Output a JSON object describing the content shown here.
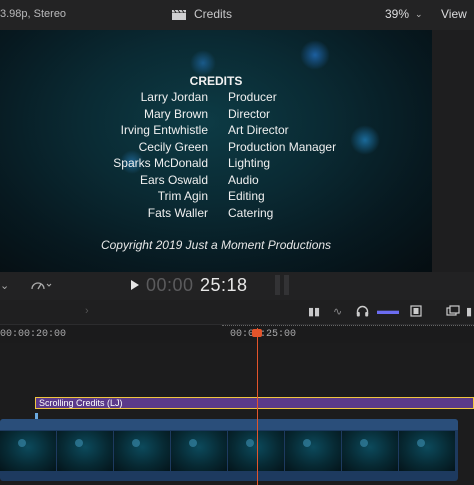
{
  "topbar": {
    "format": "3.98p, Stereo",
    "title": "Credits",
    "zoom": "39%",
    "view_label": "View"
  },
  "viewer": {
    "heading": "CREDITS",
    "credits": [
      {
        "name": "Larry Jordan",
        "role": "Producer"
      },
      {
        "name": "Mary Brown",
        "role": "Director"
      },
      {
        "name": "Irving Entwhistle",
        "role": "Art Director"
      },
      {
        "name": "Cecily Green",
        "role": "Production Manager"
      },
      {
        "name": "Sparks McDonald",
        "role": "Lighting"
      },
      {
        "name": "Ears Oswald",
        "role": "Audio"
      },
      {
        "name": "Trim Agin",
        "role": "Editing"
      },
      {
        "name": "Fats Waller",
        "role": "Catering"
      }
    ],
    "copyright": "Copyright 2019 Just a Moment Productions"
  },
  "transport": {
    "timecode_dim": "00:00",
    "timecode_bright": "25:18"
  },
  "timeline": {
    "ruler_labels": [
      "00:00:20:00",
      "00:00:25:00"
    ],
    "title_clip": "Scrolling Credits (LJ)"
  },
  "colors": {
    "playhead": "#e3542b",
    "title_clip": "#5b3a8a",
    "title_clip_border": "#f0c640",
    "video_clip": "#1d3a5f"
  }
}
